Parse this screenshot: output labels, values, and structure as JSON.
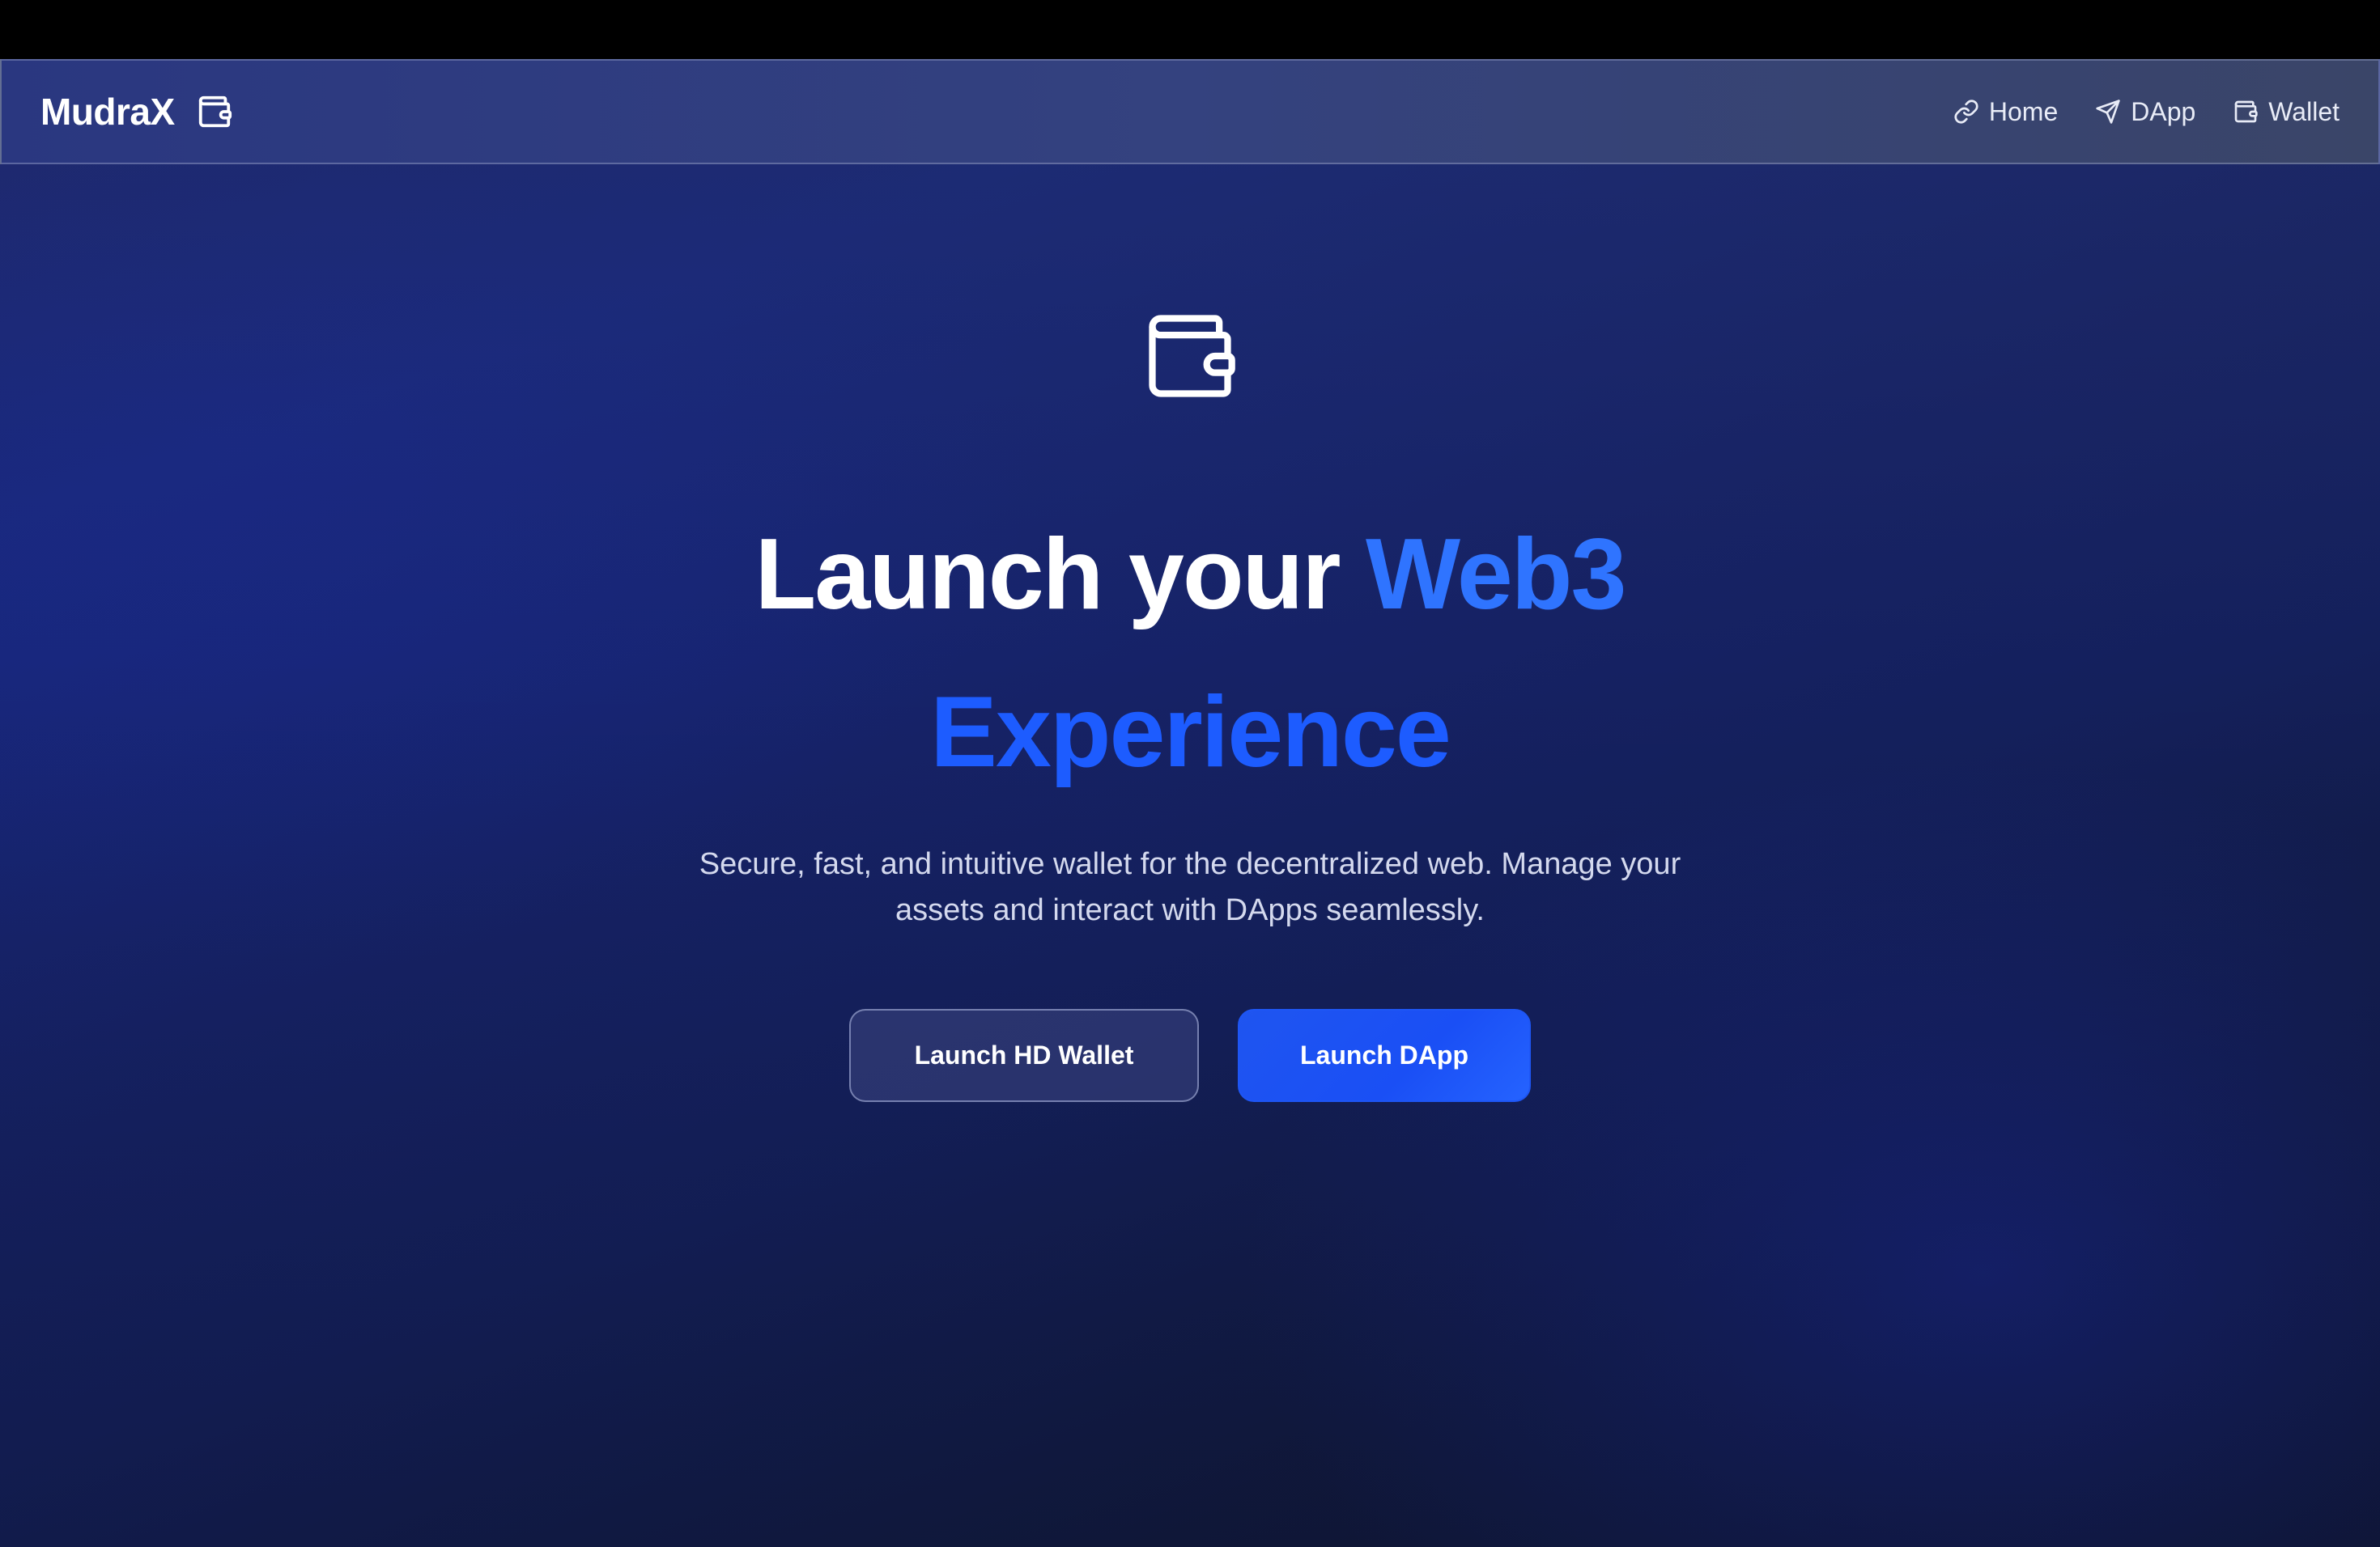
{
  "nav": {
    "brand": "MudraX",
    "brand_icon": "wallet-icon",
    "links": [
      {
        "label": "Home",
        "icon": "link-icon"
      },
      {
        "label": "DApp",
        "icon": "send-icon"
      },
      {
        "label": "Wallet",
        "icon": "wallet-icon"
      }
    ]
  },
  "hero": {
    "icon": "wallet-icon",
    "title_white": "Launch your",
    "title_accent1": "Web3",
    "title_accent2": "Experience",
    "subtitle_line1": "Secure, fast, and intuitive wallet for the decentralized web. Manage your",
    "subtitle_line2": "assets and interact with DApps seamlessly.",
    "primary_button": "Launch DApp",
    "secondary_button": "Launch HD Wallet"
  },
  "colors": {
    "accent_light": "#2f74ff",
    "accent": "#1d5cff",
    "background_dark": "#0f1630",
    "navbar": "#34427f"
  }
}
